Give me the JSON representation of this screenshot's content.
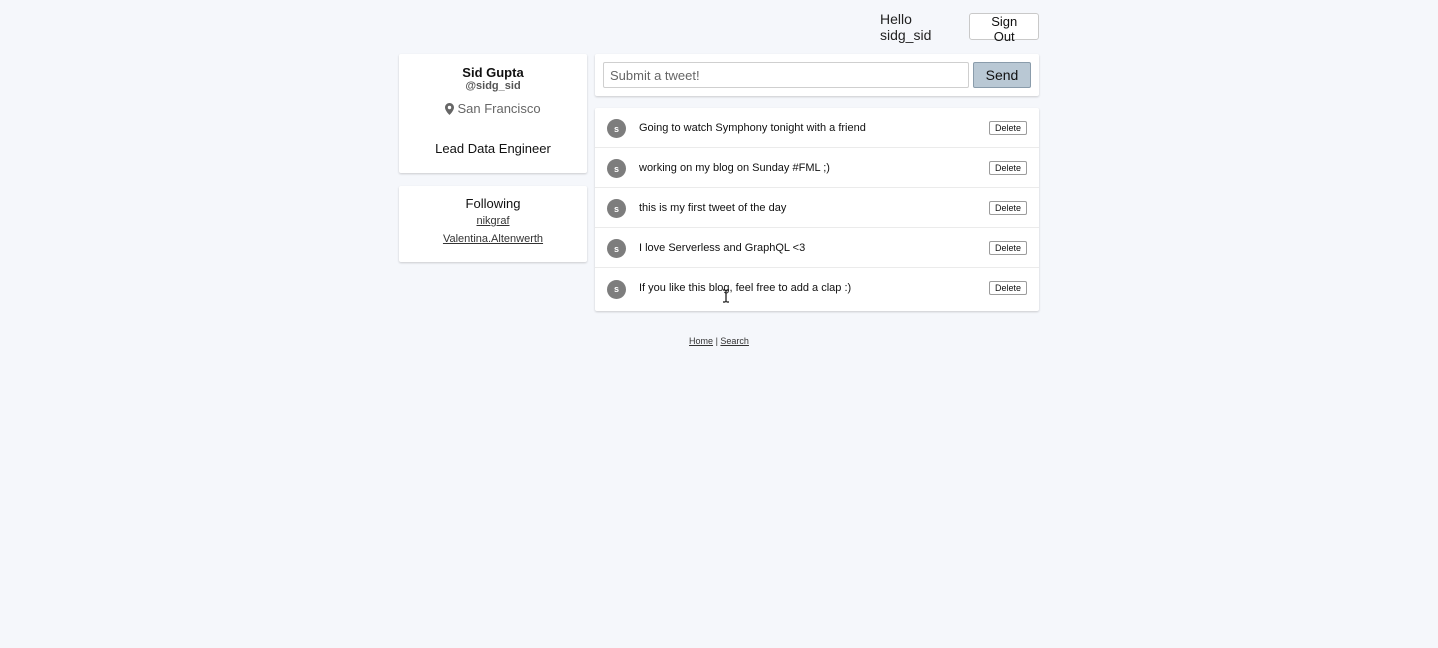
{
  "header": {
    "greeting": "Hello sidg_sid",
    "sign_out_label": "Sign Out"
  },
  "profile": {
    "name": "Sid Gupta",
    "handle": "@sidg_sid",
    "location": "San Francisco",
    "title": "Lead Data Engineer"
  },
  "following": {
    "heading": "Following",
    "users": [
      "nikgraf",
      "Valentina.Altenwerth"
    ]
  },
  "composer": {
    "placeholder": "Submit a tweet!",
    "value": "",
    "send_label": "Send"
  },
  "feed": {
    "tweets": [
      {
        "avatar": "s",
        "text": "Going to watch Symphony tonight with a friend",
        "delete_label": "Delete"
      },
      {
        "avatar": "s",
        "text": "working on my blog on Sunday #FML ;)",
        "delete_label": "Delete"
      },
      {
        "avatar": "s",
        "text": "this is my first tweet of the day",
        "delete_label": "Delete"
      },
      {
        "avatar": "s",
        "text": "I love Serverless and GraphQL <3",
        "delete_label": "Delete"
      },
      {
        "avatar": "s",
        "text": "If you like this blog, feel free to add a clap :)",
        "delete_label": "Delete"
      }
    ]
  },
  "footer": {
    "home_label": "Home",
    "separator": "|",
    "search_label": "Search"
  },
  "icons": {
    "location": "map-pin-icon",
    "cursor": "text-cursor-icon"
  },
  "colors": {
    "background": "#f5f7fb",
    "send_button": "#b9c8d4",
    "avatar": "#7d7d7d"
  }
}
